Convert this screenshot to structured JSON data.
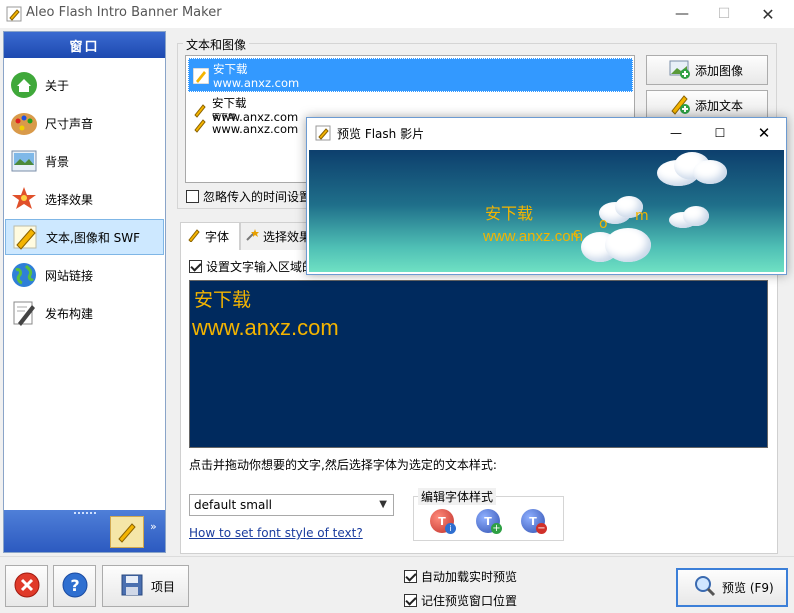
{
  "window": {
    "title": "Aleo Flash Intro Banner Maker"
  },
  "sidebar": {
    "header": "窗口",
    "items": [
      {
        "label": "关于",
        "icon": "home-icon"
      },
      {
        "label": "尺寸声音",
        "icon": "palette-icon"
      },
      {
        "label": "背景",
        "icon": "picture-icon"
      },
      {
        "label": "选择效果",
        "icon": "magic-effect-icon"
      },
      {
        "label": "文本,图像和 SWF",
        "icon": "pencil-icon",
        "selected": true
      },
      {
        "label": "网站链接",
        "icon": "globe-icon"
      },
      {
        "label": "发布构建",
        "icon": "pen-paper-icon"
      }
    ],
    "footer_more": "»"
  },
  "text_image": {
    "group_title": "文本和图像",
    "list": [
      {
        "line1": "安下载",
        "line2": "www.anxz.com",
        "selected": true
      },
      {
        "line1": "安下载",
        "line2": "www.anxz.com"
      },
      {
        "line1": "安下载",
        "line2": "www.anxz.com"
      }
    ],
    "add_image": "添加图像",
    "add_text": "添加文本",
    "ignore_time": "忽略传入的时间设置"
  },
  "tabs": {
    "font": "字体",
    "effect": "选择效果"
  },
  "font_tab": {
    "set_input_area": "设置文字输入区域的",
    "preview_line1": "安下载",
    "preview_line2": "www.anxz.com",
    "instruction": "点击并拖动你想要的文字,然后选择字体为选定的文本样式:",
    "style_value": "default small",
    "edit_style_title": "编辑字体样式",
    "help_link": "How to set font style of text?"
  },
  "preview_window": {
    "title": "预览 Flash 影片",
    "line1": "安下载",
    "line2": "www.anxz.com",
    "scattered": [
      "c",
      "o",
      "m"
    ]
  },
  "bottom": {
    "project": "项目",
    "auto_load": "自动加载实时预览",
    "remember_pos": "记住预览窗口位置",
    "preview_btn": "预览 (F9)"
  },
  "colors": {
    "accent": "#1d49b0",
    "selection": "#3399ff",
    "text_gold": "#f4b400"
  }
}
